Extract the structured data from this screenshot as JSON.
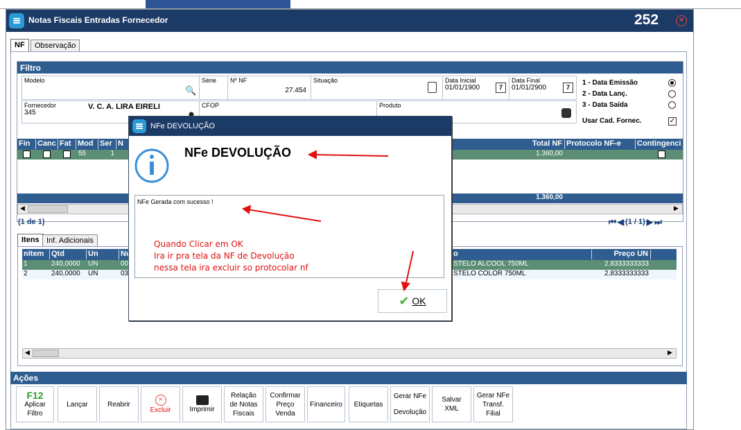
{
  "window": {
    "title": "Notas Fiscais Entradas Fornecedor",
    "number": "252"
  },
  "tabs": [
    {
      "label": "NF"
    },
    {
      "label": "Observação"
    }
  ],
  "filtro": {
    "header": "Filtro",
    "modelo_label": "Modelo",
    "serie_label": "Série",
    "nnf_label": "Nº NF",
    "nnf_value": "27.454",
    "situacao_label": "Situação",
    "data_inicial_label": "Data Inicial",
    "data_inicial_value": "01/01/1900",
    "data_final_label": "Data Final",
    "data_final_value": "01/01/2900",
    "fornecedor_label": "Fornecedor",
    "fornecedor_code": "345",
    "fornecedor_name": "V. C. A. LIRA EIRELI",
    "cfop_label": "CFOP",
    "produto_label": "Produto",
    "radio_options": [
      "1 - Data Emissão",
      "2 - Data Lanç.",
      "3 - Data Saída"
    ],
    "usar_cad_label": "Usar Cad. Fornec."
  },
  "nf_grid": {
    "columns": [
      "Fin",
      "Canc",
      "Fat",
      "Mod",
      "Ser",
      "N",
      "Total NF",
      "Protocolo NF-e",
      "Contingenci"
    ],
    "row": {
      "mod": "55",
      "ser": "1",
      "total": "1.360,00"
    },
    "footer_total": "1.360,00",
    "pager": "(1 de 1)",
    "page_nav": "(1 / 1)"
  },
  "item_tabs": [
    {
      "label": "Itens"
    },
    {
      "label": "Inf. Adicionais"
    }
  ],
  "items_grid": {
    "columns": [
      "nItem",
      "Qtd",
      "Un",
      "Nu",
      "o",
      "Preço UN"
    ],
    "rows": [
      {
        "nitem": "1",
        "qtd": "240,0000",
        "un": "UN",
        "nu": "00",
        "desc": "STELO ALCOOL 750ML",
        "preco": "2,8333333333"
      },
      {
        "nitem": "2",
        "qtd": "240,0000",
        "un": "UN",
        "nu": "03",
        "desc": "STELO COLOR 750ML",
        "preco": "2,8333333333"
      }
    ]
  },
  "acoes": {
    "header": "Ações",
    "buttons": [
      {
        "line1": "F12",
        "line2": "Aplicar",
        "line3": "Filtro"
      },
      {
        "label": "Lançar"
      },
      {
        "label": "Reabrir"
      },
      {
        "label": "Excluir"
      },
      {
        "label": "Imprimir"
      },
      {
        "lines": [
          "Relação",
          "de Notas",
          "Fiscais"
        ]
      },
      {
        "lines": [
          "Confirmar",
          "Preço",
          "Venda"
        ]
      },
      {
        "label": "Financeiro"
      },
      {
        "label": "Etiquetas"
      },
      {
        "lines": [
          "Gerar NFe",
          "",
          "Devolução"
        ]
      },
      {
        "lines": [
          "Salvar",
          "XML"
        ]
      },
      {
        "lines": [
          "Gerar NFe",
          "Transf.",
          "Filial"
        ]
      }
    ]
  },
  "dialog": {
    "title": "NFe DEVOLUÇÃO",
    "heading": "NFe DEVOLUÇÃO",
    "message": "NFe Gerada com sucesso !",
    "annotation": [
      "Quando Clicar em OK",
      "Ira ir pra tela da NF de Devolução",
      "nessa tela ira excluir so protocolar nf"
    ],
    "ok_label": "OK"
  },
  "colors": {
    "titlebar": "#1c3a66",
    "header": "#2f5d90",
    "selected_row": "#5b8e74",
    "annotation": "#e01010"
  }
}
